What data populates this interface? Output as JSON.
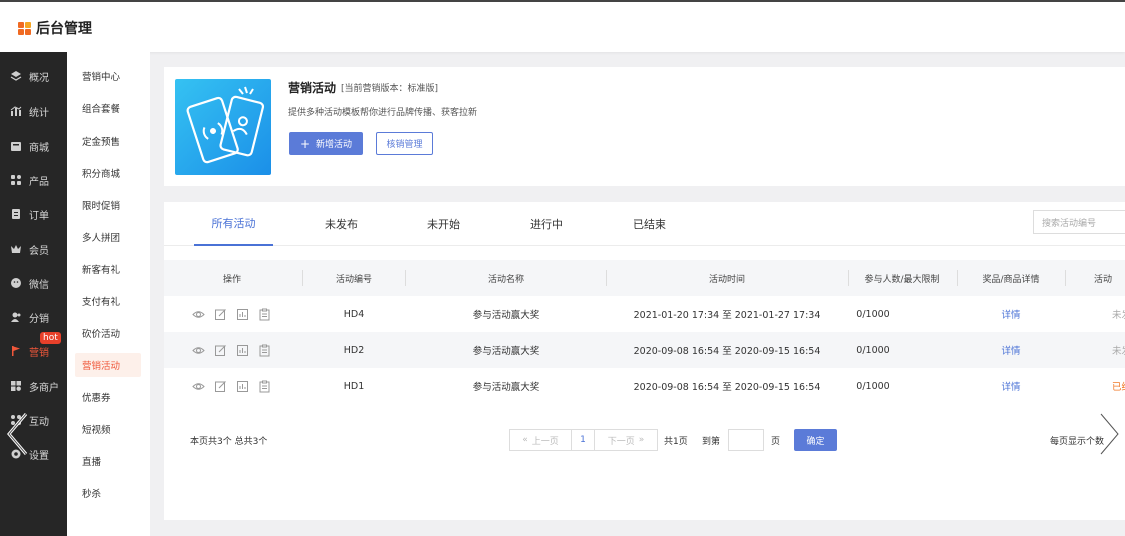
{
  "app": {
    "title": "后台管理"
  },
  "sidebar": {
    "items": [
      {
        "label": "概况",
        "icon": "layers-icon"
      },
      {
        "label": "统计",
        "icon": "chart-icon"
      },
      {
        "label": "商城",
        "icon": "store-icon"
      },
      {
        "label": "产品",
        "icon": "grid-icon"
      },
      {
        "label": "订单",
        "icon": "order-icon"
      },
      {
        "label": "会员",
        "icon": "crown-icon"
      },
      {
        "label": "微信",
        "icon": "wechat-icon"
      },
      {
        "label": "分销",
        "icon": "users-icon"
      },
      {
        "label": "营销",
        "icon": "flag-icon",
        "active": true
      },
      {
        "label": "多商户",
        "icon": "merchant-icon"
      },
      {
        "label": "互动",
        "icon": "interact-icon"
      },
      {
        "label": "设置",
        "icon": "gear-icon"
      }
    ],
    "hot_badge": "hot"
  },
  "submenu": {
    "items": [
      "营销中心",
      "组合套餐",
      "定金预售",
      "积分商城",
      "限时促销",
      "多人拼团",
      "新客有礼",
      "支付有礼",
      "砍价活动",
      "营销活动",
      "优惠券",
      "短视频",
      "直播",
      "秒杀"
    ],
    "active_index": 9
  },
  "intro": {
    "title": "营销活动",
    "version": "[当前营销版本：标准版]",
    "description": "提供多种活动模板帮你进行品牌传播、获客拉新",
    "add_button": "新增活动",
    "verify_button": "核销管理"
  },
  "tabs": [
    "所有活动",
    "未发布",
    "未开始",
    "进行中",
    "已结束"
  ],
  "active_tab": 0,
  "search": {
    "placeholder": "搜索活动编号"
  },
  "table": {
    "headers": [
      "操作",
      "活动编号",
      "活动名称",
      "活动时间",
      "参与人数/最大限制",
      "奖品/商品详情",
      "活动"
    ],
    "rows": [
      {
        "id": "HD4",
        "name": "参与活动赢大奖",
        "time": "2021-01-20 17:34 至 2021-01-27 17:34",
        "count": "0/1000",
        "detail": "详情",
        "status": "未发"
      },
      {
        "id": "HD2",
        "name": "参与活动赢大奖",
        "time": "2020-09-08 16:54 至 2020-09-15 16:54",
        "count": "0/1000",
        "detail": "详情",
        "status": "未发"
      },
      {
        "id": "HD1",
        "name": "参与活动赢大奖",
        "time": "2020-09-08 16:54 至 2020-09-15 16:54",
        "count": "0/1000",
        "detail": "详情",
        "status": "已结"
      }
    ]
  },
  "pager": {
    "summary": "本页共3个  总共3个",
    "prev": "上一页",
    "page": "1",
    "next": "下一页",
    "total_pages": "共1页",
    "goto": "到第",
    "page_unit": "页",
    "confirm": "确定",
    "per_page": "每页显示个数"
  },
  "colors": {
    "accent": "#5b7bd8",
    "active": "#f0573a",
    "sidebar_bg": "#262626"
  }
}
